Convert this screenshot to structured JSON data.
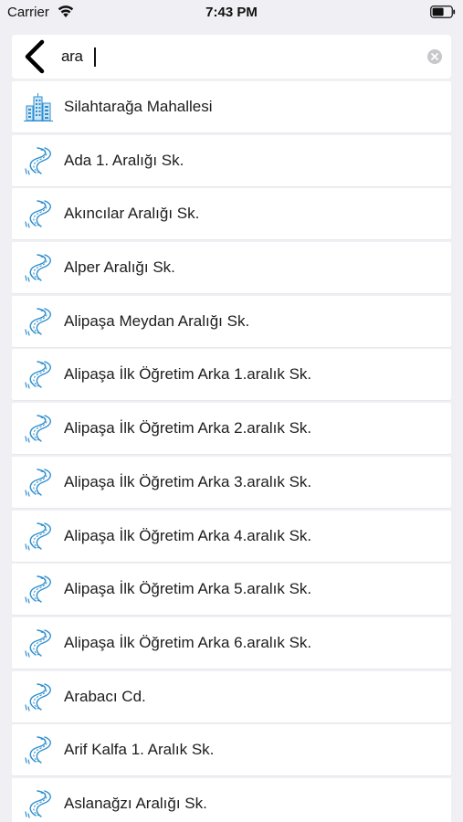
{
  "status_bar": {
    "carrier": "Carrier",
    "time": "7:43 PM"
  },
  "search": {
    "value": "ara",
    "back_icon": "chevron-left-icon",
    "clear_icon": "clear-circle-icon"
  },
  "results": [
    {
      "label": "Silahtarağa Mahallesi",
      "icon": "buildings-icon"
    },
    {
      "label": "Ada 1. Aralığı Sk.",
      "icon": "road-icon"
    },
    {
      "label": "Akıncılar Aralığı Sk.",
      "icon": "road-icon"
    },
    {
      "label": "Alper Aralığı Sk.",
      "icon": "road-icon"
    },
    {
      "label": "Alipaşa Meydan Aralığı Sk.",
      "icon": "road-icon"
    },
    {
      "label": "Alipaşa İlk Öğretim Arka 1.aralık Sk.",
      "icon": "road-icon"
    },
    {
      "label": "Alipaşa İlk Öğretim Arka 2.aralık Sk.",
      "icon": "road-icon"
    },
    {
      "label": "Alipaşa İlk Öğretim Arka 3.aralık Sk.",
      "icon": "road-icon"
    },
    {
      "label": "Alipaşa İlk Öğretim Arka 4.aralık Sk.",
      "icon": "road-icon"
    },
    {
      "label": "Alipaşa İlk Öğretim Arka 5.aralık Sk.",
      "icon": "road-icon"
    },
    {
      "label": "Alipaşa İlk Öğretim Arka 6.aralık Sk.",
      "icon": "road-icon"
    },
    {
      "label": "Arabacı Cd.",
      "icon": "road-icon"
    },
    {
      "label": "Arif Kalfa 1. Aralık Sk.",
      "icon": "road-icon"
    },
    {
      "label": "Aslanağzı Aralığı Sk.",
      "icon": "road-icon"
    }
  ],
  "colors": {
    "background": "#efeff4",
    "icon_accent": "#2e8fce"
  }
}
